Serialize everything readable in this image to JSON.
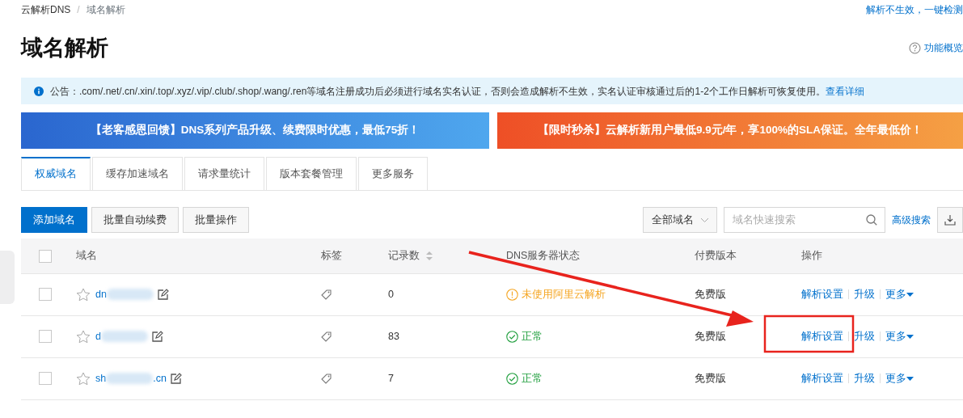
{
  "breadcrumb": [
    "云解析DNS",
    "域名解析"
  ],
  "breadcrumb_separator": "/",
  "top_link": "解析不生效，一键检测",
  "title": "域名解析",
  "help_link": "功能概览",
  "notice": {
    "text": "公告：.com/.net/.cn/.xin/.top/.xyz/.vip/.club/.shop/.wang/.ren等域名注册成功后必须进行域名实名认证，否则会造成解析不生效，实名认证审核通过后的1-2个工作日解析可恢复使用。",
    "link": "查看详细"
  },
  "banners": [
    {
      "kind": "blue",
      "text": "【老客感恩回馈】DNS系列产品升级、续费限时优惠，最低75折！"
    },
    {
      "kind": "orange",
      "text": "【限时秒杀】云解析新用户最低9.9元/年，享100%的SLA保证。全年最低价！"
    }
  ],
  "tabs": [
    {
      "label": "权威域名",
      "selected": true
    },
    {
      "label": "缓存加速域名",
      "selected": false
    },
    {
      "label": "请求量统计",
      "selected": false
    },
    {
      "label": "版本套餐管理",
      "selected": false
    },
    {
      "label": "更多服务",
      "selected": false
    }
  ],
  "toolbar": {
    "buttons": [
      {
        "label": "添加域名",
        "kind": "primary"
      },
      {
        "label": "批量自动续费",
        "kind": "default"
      },
      {
        "label": "批量操作",
        "kind": "default"
      }
    ],
    "filter": "全部域名",
    "search_placeholder": "域名快速搜索",
    "advanced_search": "高级搜索"
  },
  "table": {
    "select_all_checked": false,
    "columns": [
      {
        "label": "域名",
        "sortable": false
      },
      {
        "label": "标签",
        "sortable": false
      },
      {
        "label": "记录数",
        "sortable": true
      },
      {
        "label": "DNS服务器状态",
        "sortable": false
      },
      {
        "label": "付费版本",
        "sortable": false
      },
      {
        "label": "操作",
        "sortable": false
      }
    ],
    "rows": [
      {
        "checked": false,
        "starred": false,
        "domain_start": "dn",
        "records": "0",
        "status": {
          "kind": "warning",
          "text": "未使用阿里云解析"
        },
        "plan": "免费版",
        "actions": [
          "解析设置",
          "升级",
          "更多"
        ]
      },
      {
        "checked": false,
        "starred": false,
        "domain_start": "d",
        "records": "83",
        "status": {
          "kind": "ok",
          "text": "正常"
        },
        "plan": "免费版",
        "actions": [
          "解析设置",
          "升级",
          "更多"
        ]
      },
      {
        "checked": false,
        "starred": false,
        "domain_start": "sh",
        "domain_end": ".cn",
        "records": "7",
        "status": {
          "kind": "ok",
          "text": "正常"
        },
        "plan": "免费版",
        "actions": [
          "解析设置",
          "升级",
          "更多"
        ]
      }
    ]
  }
}
